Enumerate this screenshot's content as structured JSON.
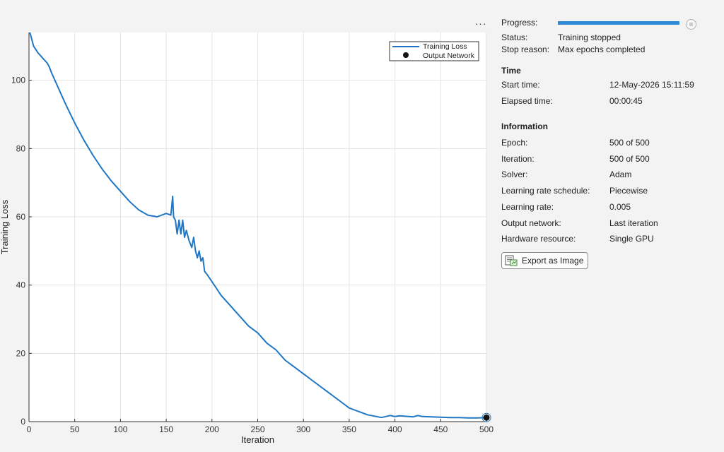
{
  "chart_data": {
    "type": "line",
    "xlabel": "Iteration",
    "ylabel": "Training Loss",
    "xlim": [
      0,
      500
    ],
    "ylim": [
      0,
      114
    ],
    "xticks": [
      0,
      50,
      100,
      150,
      200,
      250,
      300,
      350,
      400,
      450,
      500
    ],
    "yticks": [
      0,
      20,
      40,
      60,
      80,
      100
    ],
    "grid": true,
    "legend_position": "top-right",
    "series": [
      {
        "name": "Training Loss",
        "color": "#1f77c4",
        "x": [
          1,
          2,
          5,
          10,
          15,
          20,
          22,
          25,
          30,
          40,
          50,
          60,
          70,
          80,
          90,
          100,
          110,
          120,
          130,
          140,
          150,
          155,
          156,
          157,
          158,
          160,
          162,
          164,
          166,
          168,
          170,
          172,
          175,
          178,
          180,
          182,
          184,
          186,
          188,
          190,
          192,
          195,
          200,
          205,
          210,
          220,
          230,
          240,
          250,
          260,
          270,
          280,
          290,
          300,
          310,
          320,
          330,
          340,
          350,
          360,
          370,
          380,
          385,
          390,
          395,
          400,
          405,
          410,
          420,
          425,
          430,
          440,
          450,
          460,
          470,
          480,
          490,
          500
        ],
        "values": [
          114,
          113,
          110,
          108,
          106.5,
          105,
          104,
          102,
          99,
          93,
          87.5,
          82.5,
          78,
          74,
          70.5,
          67.5,
          64.5,
          62,
          60.5,
          60,
          61,
          60.5,
          63,
          66,
          60,
          59,
          55,
          59,
          55,
          59,
          54,
          56,
          53,
          51,
          54,
          50,
          48,
          50,
          47,
          48,
          44,
          43,
          41,
          39,
          37,
          34,
          31,
          28,
          26,
          23,
          21,
          18,
          16,
          14,
          12,
          10,
          8,
          6,
          4,
          3,
          2,
          1.5,
          1.2,
          1.5,
          1.8,
          1.5,
          1.7,
          1.6,
          1.4,
          1.8,
          1.5,
          1.4,
          1.3,
          1.2,
          1.2,
          1.1,
          1.1,
          1.2
        ]
      },
      {
        "name": "Output Network",
        "type": "scatter",
        "color": "#111111",
        "x": [
          500
        ],
        "values": [
          1.2
        ]
      }
    ]
  },
  "toolbar": {
    "more_label": "···"
  },
  "progress": {
    "label": "Progress:",
    "fraction": 1.0
  },
  "status": {
    "label": "Status:",
    "value": "Training stopped"
  },
  "stop_reason": {
    "label": "Stop reason:",
    "value": "Max epochs completed"
  },
  "time": {
    "title": "Time",
    "start_label": "Start time:",
    "start_value": "12-May-2026 15:11:59",
    "elapsed_label": "Elapsed time:",
    "elapsed_value": "00:00:45"
  },
  "info": {
    "title": "Information",
    "rows": [
      {
        "label": "Epoch:",
        "value": "500 of 500"
      },
      {
        "label": "Iteration:",
        "value": "500 of 500"
      },
      {
        "label": "Solver:",
        "value": "Adam"
      },
      {
        "label": "Learning rate schedule:",
        "value": "Piecewise"
      },
      {
        "label": "Learning rate:",
        "value": "0.005"
      },
      {
        "label": "Output network:",
        "value": "Last iteration"
      },
      {
        "label": "Hardware resource:",
        "value": "Single GPU"
      }
    ]
  },
  "export": {
    "label": "Export as Image",
    "icon": "export-image-icon"
  }
}
